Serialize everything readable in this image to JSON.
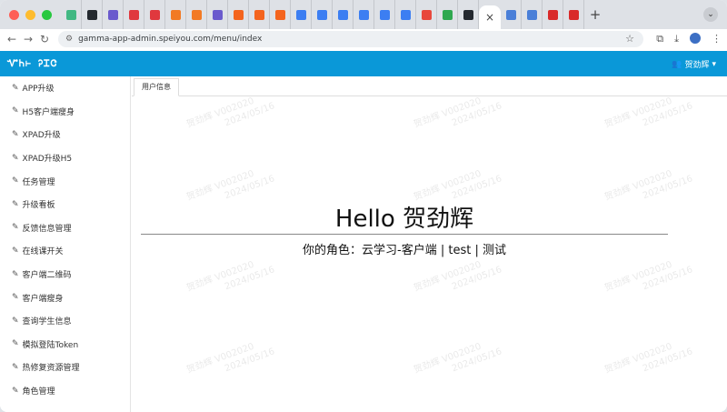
{
  "browser": {
    "url": "gamma-app-admin.speiyou.com/menu/index",
    "tabs": [
      {
        "icon": "vue-icon",
        "color": "#41b883"
      },
      {
        "icon": "github-icon",
        "color": "#24292f"
      },
      {
        "icon": "app-icon",
        "color": "#6a5acd"
      },
      {
        "icon": "app-icon-red",
        "color": "#e0383e"
      },
      {
        "icon": "app-icon-red",
        "color": "#e0383e"
      },
      {
        "icon": "code-icon",
        "color": "#f27a24"
      },
      {
        "icon": "code-icon",
        "color": "#f27a24"
      },
      {
        "icon": "app-icon",
        "color": "#6a5acd"
      },
      {
        "icon": "grid-icon",
        "color": "#f4641e"
      },
      {
        "icon": "grid-icon",
        "color": "#f4641e"
      },
      {
        "icon": "grid-icon",
        "color": "#f4641e"
      },
      {
        "icon": "doc-icon",
        "color": "#3c7ef2"
      },
      {
        "icon": "doc-icon",
        "color": "#3c7ef2"
      },
      {
        "icon": "doc-icon",
        "color": "#3c7ef2"
      },
      {
        "icon": "doc-icon",
        "color": "#3c7ef2"
      },
      {
        "icon": "doc-icon",
        "color": "#3c7ef2"
      },
      {
        "icon": "doc-icon",
        "color": "#3c7ef2"
      },
      {
        "icon": "bars-icon",
        "color": "#e8473c"
      },
      {
        "icon": "mail-icon",
        "color": "#2fa84f"
      },
      {
        "icon": "github-icon",
        "color": "#24292f"
      }
    ],
    "active_tab_label": "×",
    "after_tabs": [
      {
        "icon": "cloud-icon",
        "color": "#4a7fd8"
      },
      {
        "icon": "cloud-icon",
        "color": "#4a7fd8"
      },
      {
        "icon": "w-icon",
        "color": "#d92a2a"
      },
      {
        "icon": "jd-icon",
        "color": "#d92a2a"
      }
    ],
    "new_tab_label": "+",
    "tab_menu_label": "⌄"
  },
  "app": {
    "logo_text": "ᏉᏂ⊢ ᎮᏆᏣ",
    "user_name": "贺劲辉"
  },
  "sidebar": {
    "items": [
      {
        "label": "APP升级"
      },
      {
        "label": "H5客户端瘦身"
      },
      {
        "label": "XPAD升级"
      },
      {
        "label": "XPAD升级H5"
      },
      {
        "label": "任务管理"
      },
      {
        "label": "升级看板"
      },
      {
        "label": "反馈信息管理"
      },
      {
        "label": "在线课开关"
      },
      {
        "label": "客户端二维码"
      },
      {
        "label": "客户端瘦身"
      },
      {
        "label": "查询学生信息"
      },
      {
        "label": "模拟登陆Token"
      },
      {
        "label": "热修复资源管理"
      },
      {
        "label": "角色管理"
      }
    ]
  },
  "main": {
    "tab_label": "用户信息",
    "greeting": "Hello 贺劲辉",
    "role_text": "你的角色：云学习-客户端 | test | 测试",
    "watermark_name": "贺劲辉 V002020",
    "watermark_date": "2024/05/16"
  }
}
